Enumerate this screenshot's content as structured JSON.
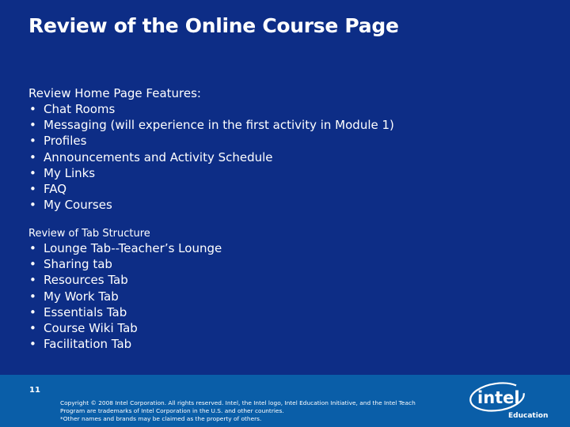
{
  "slide": {
    "title": "Review of the Online Course Page",
    "sections": [
      {
        "heading": "Review Home Page Features:",
        "items": [
          "Chat Rooms",
          "Messaging (will experience in the first activity in Module 1)",
          "Profiles",
          "Announcements and Activity Schedule",
          "My Links",
          "FAQ",
          "My Courses"
        ]
      },
      {
        "heading": "Review of Tab Structure",
        "items": [
          "Lounge Tab--Teacher’s Lounge",
          "Sharing tab",
          "Resources Tab",
          "My Work Tab",
          "Essentials Tab",
          "Course Wiki Tab",
          "Facilitation Tab"
        ]
      }
    ],
    "bullet_glyph": "•"
  },
  "footer": {
    "page_number": "11",
    "copyright_lines": [
      "Copyright © 2008 Intel Corporation. All rights reserved. Intel, the Intel logo, Intel Education Initiative, and the Intel Teach",
      "Program are trademarks of Intel Corporation in the U.S. and other countries.",
      "*Other names and brands may be claimed as the property of others."
    ],
    "logo": {
      "wordmark": "intel",
      "subtitle": "Education",
      "icon": "intel-logo-icon"
    }
  },
  "colors": {
    "background": "#0d2d86",
    "footer_band": "#0a5ea8",
    "text": "#ffffff"
  }
}
